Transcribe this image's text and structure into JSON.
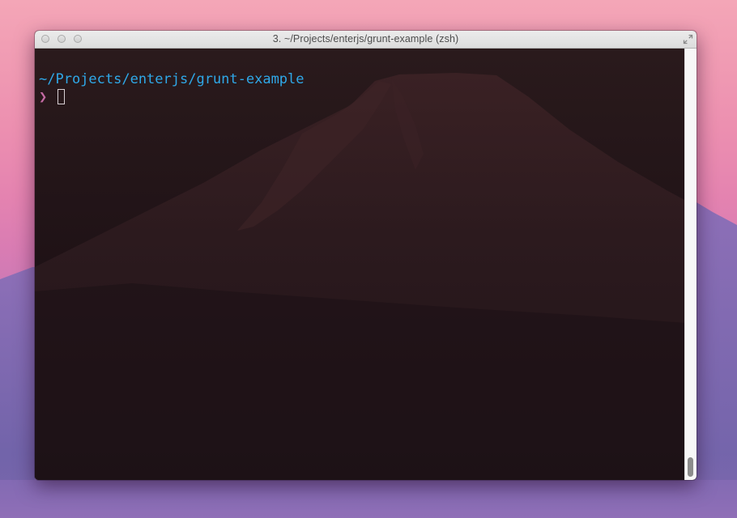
{
  "window": {
    "title": "3. ~/Projects/enterjs/grunt-example (zsh)",
    "controls": {
      "close": "close-button",
      "minimize": "minimize-button",
      "zoom": "zoom-button",
      "fullscreen_icon": "fullscreen-arrows-icon"
    }
  },
  "terminal": {
    "prompt_path": "~/Projects/enterjs/grunt-example",
    "prompt_symbol": "❯",
    "input_value": "",
    "colors": {
      "path": "#2fa8e8",
      "prompt_symbol": "#c46aa3",
      "background": "#1e1118"
    }
  },
  "scrollbar": {
    "position": 1.0
  },
  "desktop": {
    "wallpaper": "mountain at dusk, pink-purple sky"
  }
}
